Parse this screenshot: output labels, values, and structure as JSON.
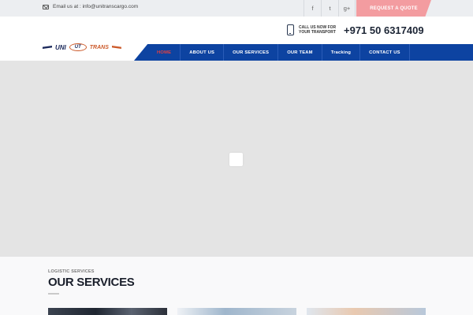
{
  "topbar": {
    "email_text": "Email us at : info@unitranscargo.com",
    "social": [
      {
        "icon": "facebook-icon",
        "glyph": "f"
      },
      {
        "icon": "twitter-icon",
        "glyph": "t"
      },
      {
        "icon": "google-plus-icon",
        "glyph": "g+"
      }
    ],
    "quote_button": "REQUEST A QUOTE"
  },
  "header": {
    "call_text": "CALL US NOW FOR YOUR TRANSPORT",
    "phone_number": "+971 50 6317409",
    "logo": {
      "left": "UNI",
      "mark": "UT",
      "right": "TRANS"
    }
  },
  "nav": {
    "items": [
      {
        "label": "HOME",
        "active": true
      },
      {
        "label": "ABOUT US"
      },
      {
        "label": "OUR SERVICES"
      },
      {
        "label": "OUR TEAM"
      },
      {
        "label": "Tracking"
      },
      {
        "label": "CONTACT US"
      }
    ]
  },
  "services": {
    "kicker": "LOGISTIC SERVICES",
    "title": "OUR SERVICES"
  },
  "colors": {
    "nav_bg": "#0d43a1",
    "active_nav": "#e7403e",
    "quote_bg": "#f39ca0",
    "brand_orange": "#cc5a2a",
    "brand_navy": "#1c2a5c"
  }
}
